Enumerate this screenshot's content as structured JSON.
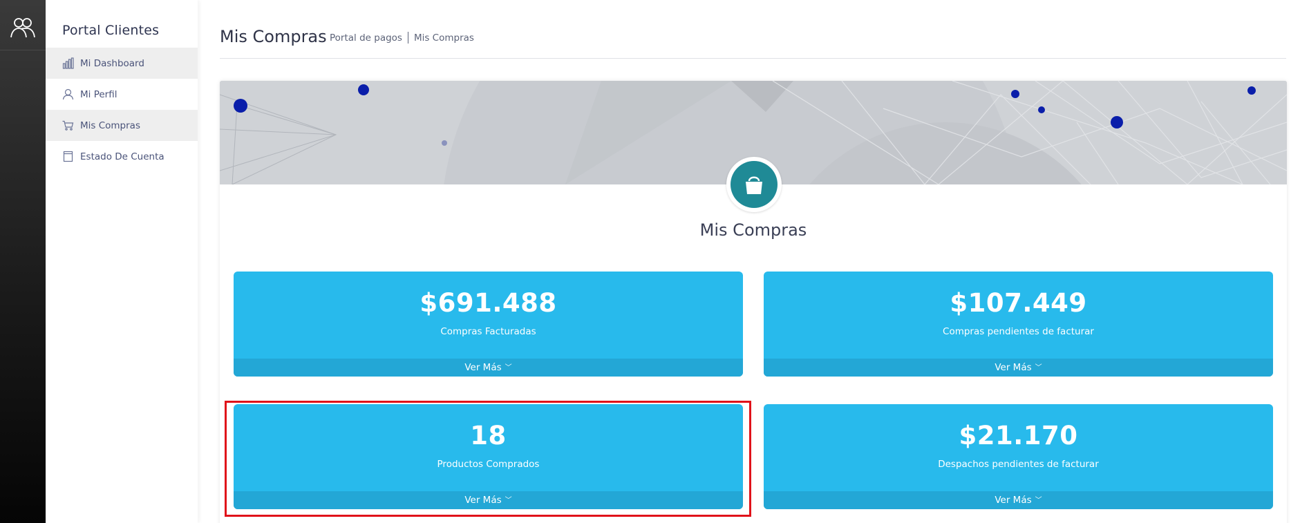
{
  "colors": {
    "rail": "#1b1b1b",
    "accent_tile": "#28baec",
    "tile_footer": "#23a7d6",
    "avatar": "#1f8a96",
    "highlight": "#e0121a",
    "banner_dot": "#0a1eaa"
  },
  "rail": {
    "logo_icon": "users-icon"
  },
  "sidebar": {
    "title": "Portal Clientes",
    "items": [
      {
        "label": "Mi Dashboard",
        "icon": "bar-chart-icon"
      },
      {
        "label": "Mi Perfil",
        "icon": "user-icon"
      },
      {
        "label": "Mis Compras",
        "icon": "cart-icon"
      },
      {
        "label": "Estado De Cuenta",
        "icon": "document-icon"
      }
    ]
  },
  "header": {
    "title": "Mis Compras",
    "breadcrumb": [
      "Portal de pagos",
      "Mis Compras"
    ]
  },
  "card": {
    "title": "Mis Compras",
    "avatar_icon": "shopping-bag-icon"
  },
  "tiles": [
    {
      "value": "$691.488",
      "label": "Compras Facturadas",
      "link": "Ver Más"
    },
    {
      "value": "$107.449",
      "label": "Compras pendientes de facturar",
      "link": "Ver Más"
    },
    {
      "value": "18",
      "label": "Productos Comprados",
      "link": "Ver Más",
      "highlighted": true
    },
    {
      "value": "$21.170",
      "label": "Despachos pendientes de facturar",
      "link": "Ver Más"
    }
  ]
}
